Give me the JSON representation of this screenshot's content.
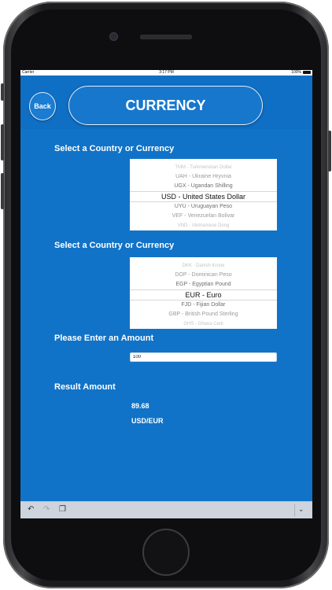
{
  "status_bar": {
    "carrier": "Carrier",
    "time": "3:17 PM",
    "battery": "100%"
  },
  "header": {
    "back_label": "Back",
    "title": "CURRENCY"
  },
  "from_section": {
    "label": "Select a Country or Currency",
    "options": [
      "TMM - Turkmenistan Dollar",
      "UAH - Ukraine Hryvnia",
      "UGX - Ugandan Shilling",
      "USD - United States Dollar",
      "UYU - Uruguayan Peso",
      "VEF - Venezuelan Bolivar",
      "VND - Vietnamese Dong"
    ],
    "selected": "USD - United States Dollar"
  },
  "to_section": {
    "label": "Select a Country or Currency",
    "options": [
      "DKK - Danish Krone",
      "DOP - Dominican Peso",
      "EGP - Egyptian Pound",
      "EUR - Euro",
      "FJD - Fijian Dollar",
      "GBP - British Pound Sterling",
      "GHS - Ghana Cedi"
    ],
    "selected": "EUR - Euro"
  },
  "amount": {
    "label": "Please Enter an Amount",
    "value": "100"
  },
  "result": {
    "label": "Result Amount",
    "value": "89.68",
    "pair": "USD/EUR"
  },
  "toolbar": {
    "undo_icon": "undo-icon",
    "redo_icon": "redo-icon",
    "paste_icon": "paste-icon",
    "chevron_icon": "chevron-down-icon"
  },
  "colors": {
    "screen_bg": "#1173c7",
    "header_bg": "#0f6fc4",
    "button_border": "#e6f0fb",
    "toolbar_bg": "#cdd4dd"
  }
}
